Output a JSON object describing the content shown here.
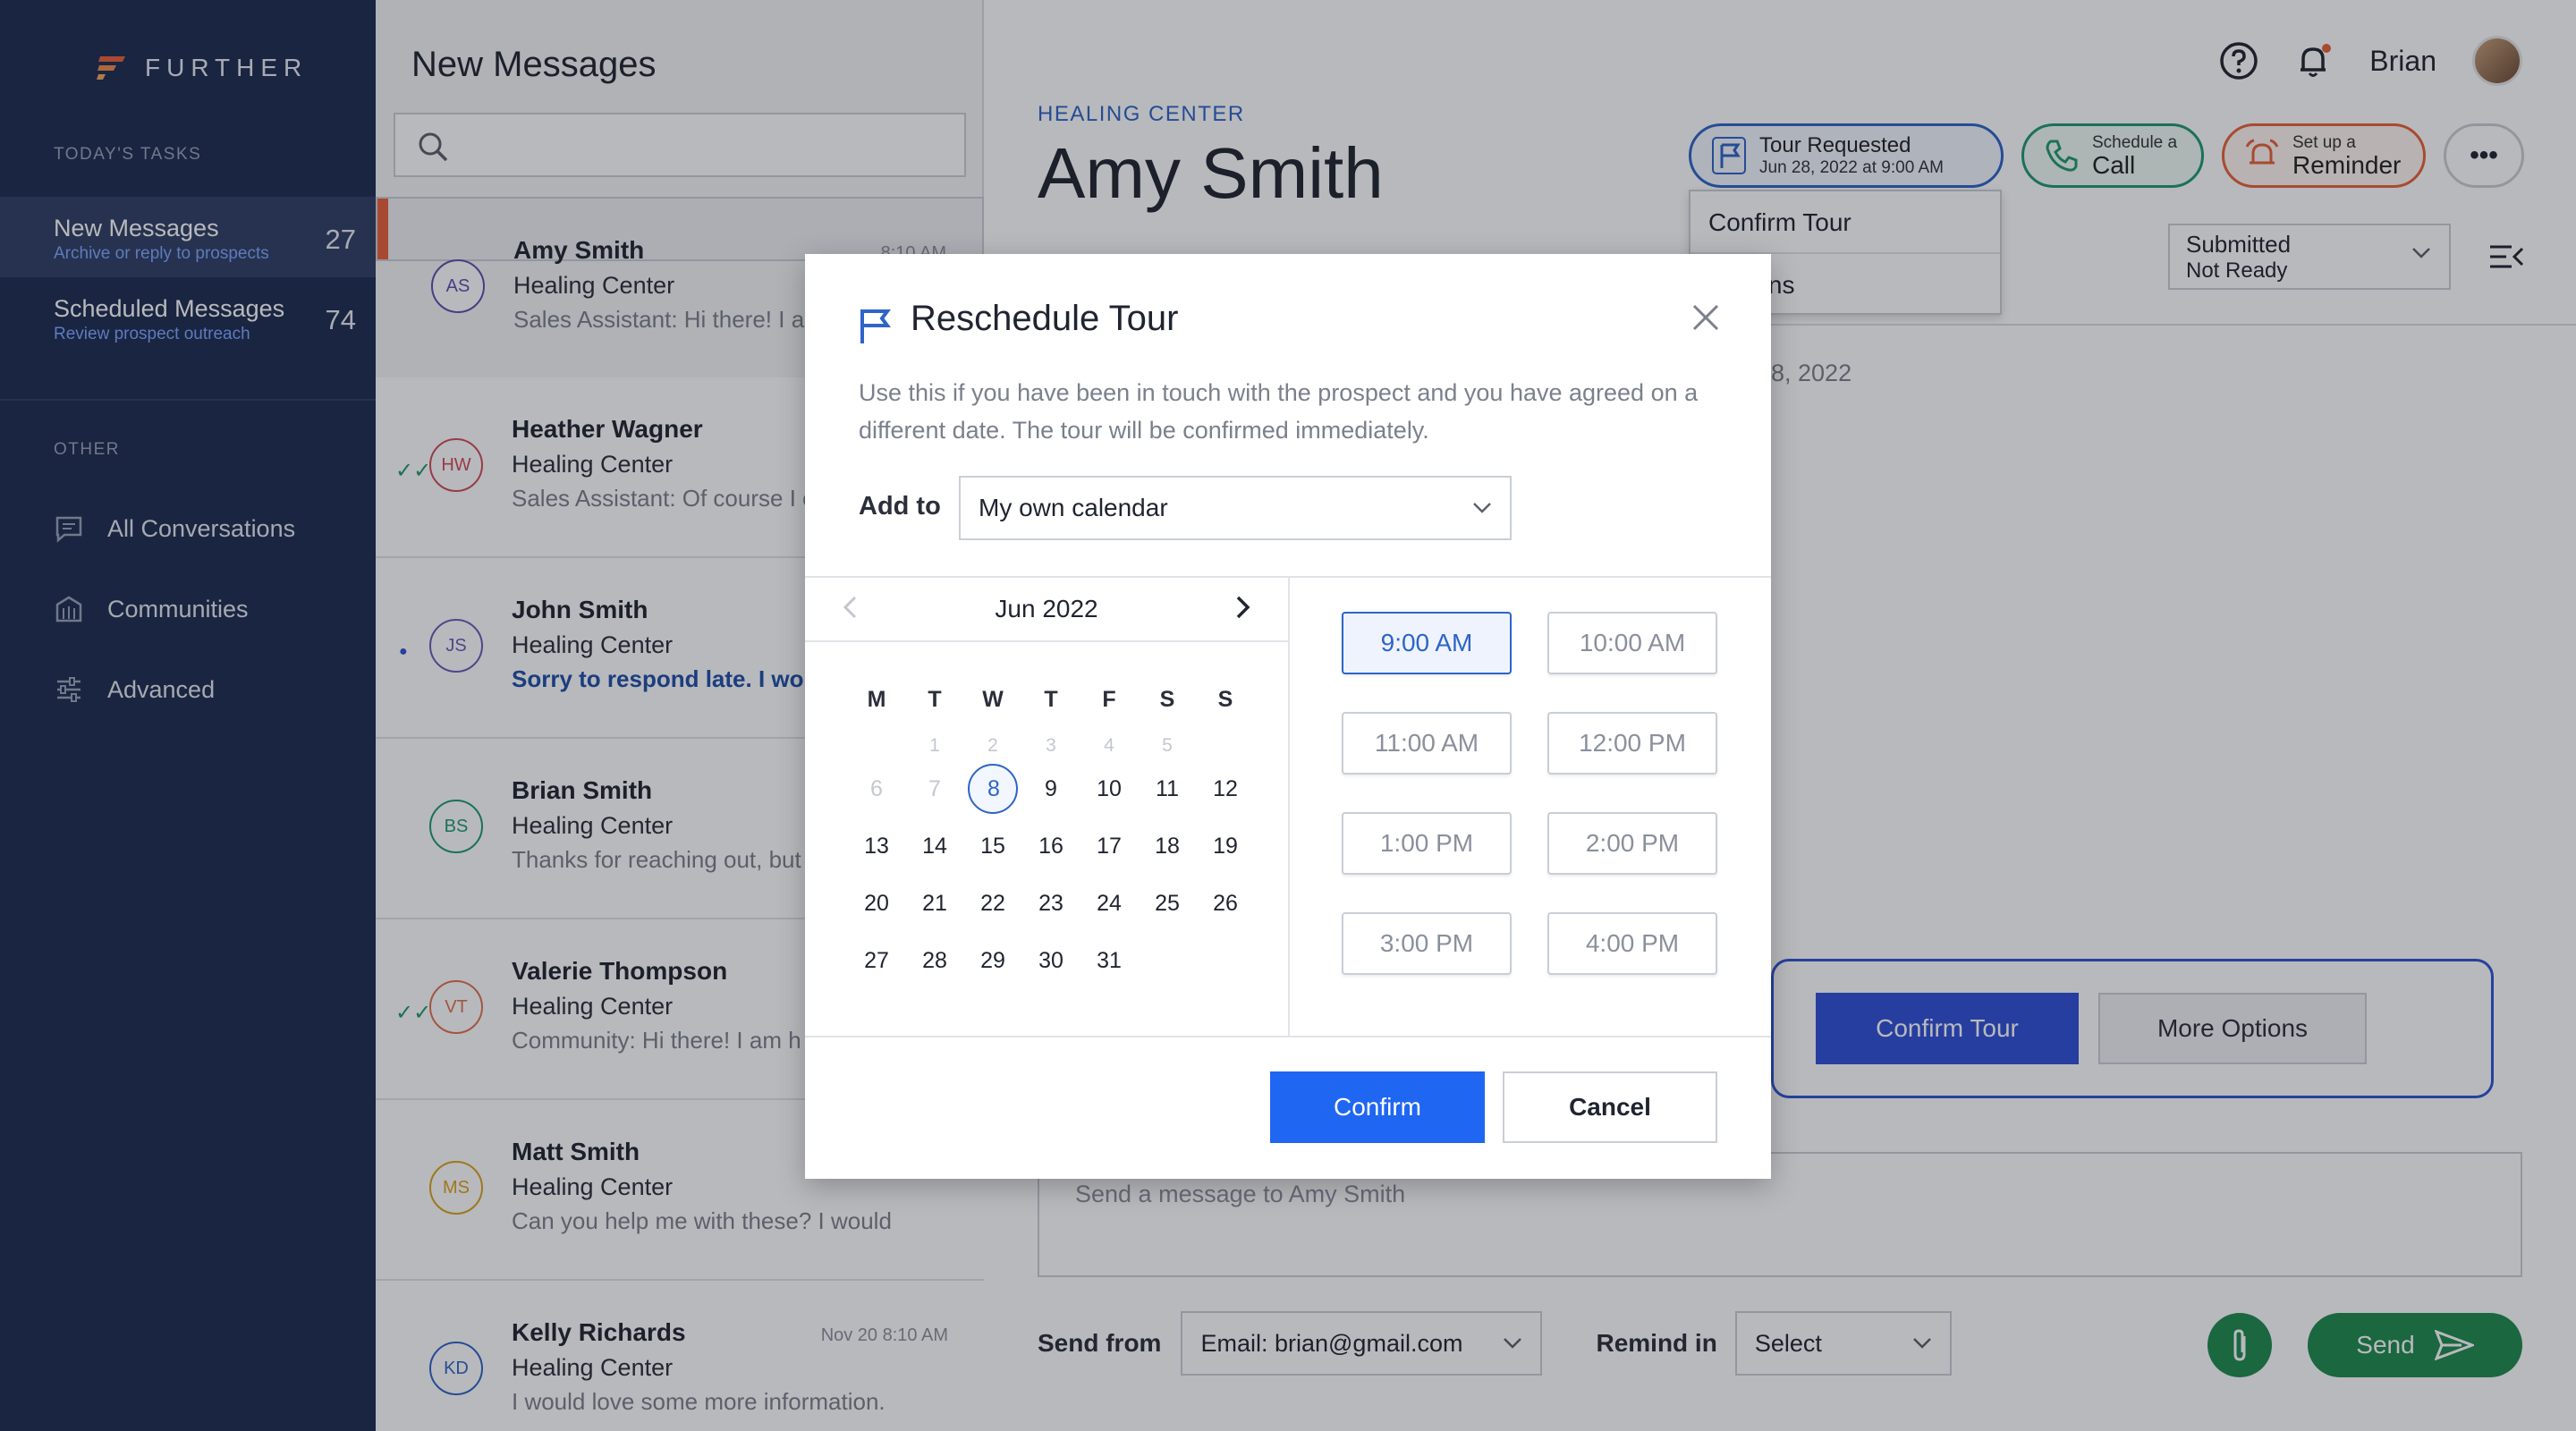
{
  "colors": {
    "sidebar_bg": "#1c2b50",
    "accent_blue": "#1f66f2",
    "send_green": "#1e8a4e",
    "selected_bar": "#e8613a"
  },
  "sidebar": {
    "logo": "FURTHER",
    "todays_tasks_label": "TODAY'S TASKS",
    "tasks": [
      {
        "title": "New Messages",
        "subtitle": "Archive or reply to prospects",
        "count": "27"
      },
      {
        "title": "Scheduled Messages",
        "subtitle": "Review prospect outreach",
        "count": "74"
      }
    ],
    "other_label": "OTHER",
    "nav": [
      {
        "label": "All Conversations",
        "icon": "chat-icon"
      },
      {
        "label": "Communities",
        "icon": "building-icon"
      },
      {
        "label": "Advanced",
        "icon": "sliders-icon"
      }
    ]
  },
  "list": {
    "title": "New Messages",
    "search_placeholder": "",
    "conversations": [
      {
        "initials": "AS",
        "name": "Amy Smith",
        "center": "Healing Center",
        "snippet": "Sales Assistant: Hi there! I am",
        "time": "8:10 AM",
        "color": "#5b4fb0",
        "mark": ""
      },
      {
        "initials": "HW",
        "name": "Heather Wagner",
        "center": "Healing Center",
        "snippet": "Sales Assistant: Of course I c",
        "time": "",
        "color": "#d04b5a",
        "mark": "✓✓"
      },
      {
        "initials": "JS",
        "name": "John Smith",
        "center": "Healing Center",
        "snippet": "Sorry to respond late. I wo",
        "time": "",
        "color": "#6b5bb8",
        "mark": "●"
      },
      {
        "initials": "BS",
        "name": "Brian Smith",
        "center": "Healing Center",
        "snippet": "Thanks for reaching out, but",
        "time": "",
        "color": "#1e9a6e",
        "mark": ""
      },
      {
        "initials": "VT",
        "name": "Valerie Thompson",
        "center": "Healing Center",
        "snippet": "Community: Hi there! I am h",
        "time": "",
        "color": "#e07050",
        "mark": "✓✓"
      },
      {
        "initials": "MS",
        "name": "Matt Smith",
        "center": "Healing Center",
        "snippet": "Can you help me with these? I would",
        "time": "",
        "color": "#d9a21e",
        "mark": ""
      },
      {
        "initials": "KD",
        "name": "Kelly Richards",
        "center": "Healing Center",
        "snippet": "I would love some more information.",
        "time": "Nov 20 8:10 AM",
        "color": "#2e64c8",
        "mark": ""
      }
    ]
  },
  "header": {
    "help_icon": "question-icon",
    "bell_icon": "bell-icon",
    "user_name": "Brian"
  },
  "prospect": {
    "crumb": "HEALING CENTER",
    "name": "Amy Smith"
  },
  "actions": {
    "tour": {
      "line1": "Tour Requested",
      "line2": "Jun 28, 2022 at 9:00 AM"
    },
    "call": {
      "line1": "Schedule a",
      "line2": "Call"
    },
    "reminder": {
      "line1": "Set up a",
      "line2": "Reminder"
    },
    "more": "•••",
    "tour_menu": [
      "Confirm Tour",
      "Options"
    ]
  },
  "status": {
    "line1": "Submitted",
    "line2": "Not Ready"
  },
  "timeline": {
    "date_fragment": "8, 2022"
  },
  "tour_card": {
    "confirm": "Confirm Tour",
    "more": "More Options"
  },
  "composer": {
    "placeholder": "Send a message to Amy Smith",
    "send_from_label": "Send from",
    "send_from_value": "Email: brian@gmail.com",
    "remind_label": "Remind in",
    "remind_value": "Select",
    "send_label": "Send"
  },
  "modal": {
    "title": "Reschedule Tour",
    "description": "Use this if you have been in touch with the prospect and you have agreed on a different date. The tour will be confirmed immediately.",
    "add_to_label": "Add to",
    "add_to_value": "My own calendar",
    "calendar": {
      "month": "Jun 2022",
      "weekdays": [
        "M",
        "T",
        "W",
        "T",
        "F",
        "S",
        "S"
      ],
      "weeks": [
        [
          {
            "d": "",
            "m": true
          },
          {
            "d": "1",
            "m": true
          },
          {
            "d": "2",
            "m": true
          },
          {
            "d": "3",
            "m": true
          },
          {
            "d": "4",
            "m": true
          },
          {
            "d": "5",
            "m": true
          },
          {
            "d": "",
            "m": true
          }
        ],
        [
          {
            "d": "6",
            "m": true
          },
          {
            "d": "7",
            "m": true
          },
          {
            "d": "8",
            "s": true
          },
          {
            "d": "9"
          },
          {
            "d": "10"
          },
          {
            "d": "11"
          },
          {
            "d": "12"
          }
        ],
        [
          {
            "d": "13"
          },
          {
            "d": "14"
          },
          {
            "d": "15"
          },
          {
            "d": "16"
          },
          {
            "d": "17"
          },
          {
            "d": "18"
          },
          {
            "d": "19"
          }
        ],
        [
          {
            "d": "20"
          },
          {
            "d": "21"
          },
          {
            "d": "22"
          },
          {
            "d": "23"
          },
          {
            "d": "24"
          },
          {
            "d": "25"
          },
          {
            "d": "26"
          }
        ],
        [
          {
            "d": "27"
          },
          {
            "d": "28"
          },
          {
            "d": "29"
          },
          {
            "d": "30"
          },
          {
            "d": "31"
          },
          {
            "d": ""
          },
          {
            "d": ""
          }
        ]
      ]
    },
    "times": [
      "9:00 AM",
      "10:00 AM",
      "11:00 AM",
      "12:00 PM",
      "1:00 PM",
      "2:00 PM",
      "3:00 PM",
      "4:00 PM"
    ],
    "selected_time": "9:00 AM",
    "confirm": "Confirm",
    "cancel": "Cancel"
  }
}
